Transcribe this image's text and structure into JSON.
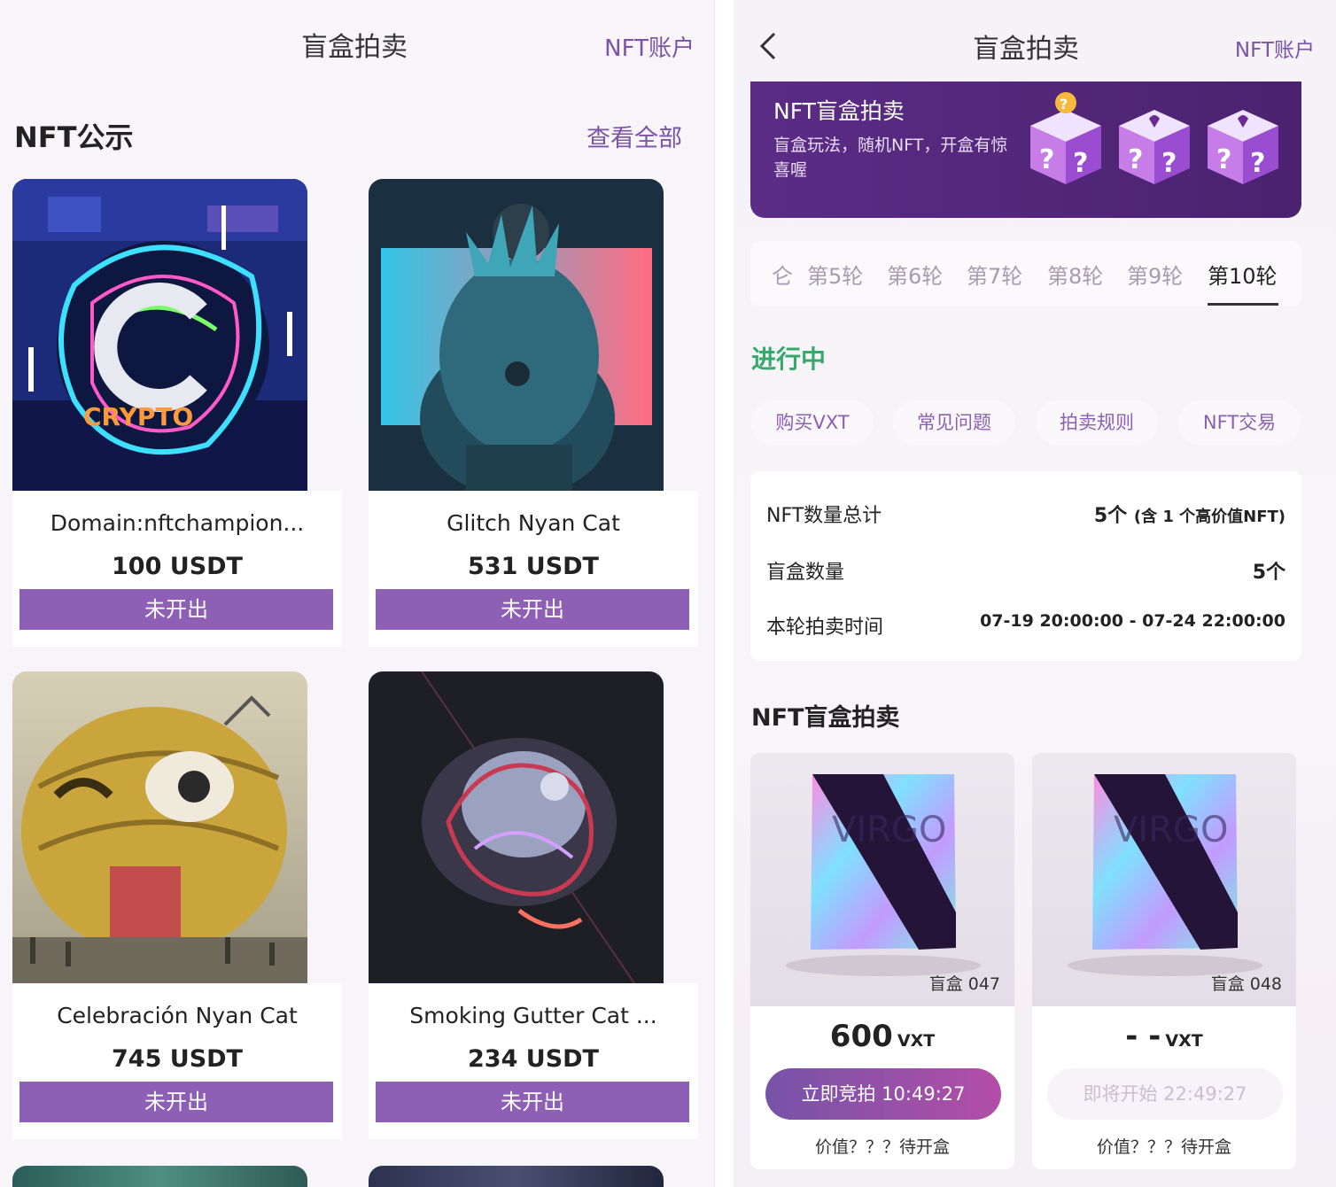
{
  "left": {
    "header": {
      "title": "盲盒拍卖",
      "account_label": "NFT账户"
    },
    "section": {
      "title": "NFT公示",
      "view_all": "查看全部"
    },
    "cards": [
      {
        "name": "Domain:nftchampion...",
        "price": "100 USDT",
        "status": "未开出"
      },
      {
        "name": "Glitch Nyan Cat",
        "price": "531 USDT",
        "status": "未开出"
      },
      {
        "name": "Celebración Nyan Cat",
        "price": "745 USDT",
        "status": "未开出"
      },
      {
        "name": "Smoking Gutter Cat ...",
        "price": "234 USDT",
        "status": "未开出"
      }
    ]
  },
  "right": {
    "header": {
      "title": "盲盒拍卖",
      "account_label": "NFT账户"
    },
    "banner": {
      "title": "NFT盲盒拍卖",
      "desc": "盲盒玩法，随机NFT，开盒有惊喜喔"
    },
    "rounds": {
      "items": [
        "仑",
        "第5轮",
        "第6轮",
        "第7轮",
        "第8轮",
        "第9轮",
        "第10轮"
      ],
      "active_index": 6
    },
    "status_title": "进行中",
    "quick_links": [
      "购买VXT",
      "常见问题",
      "拍卖规则",
      "NFT交易"
    ],
    "stats": [
      {
        "label": "NFT数量总计",
        "value": "5个",
        "note": "(含 1 个高价值NFT)"
      },
      {
        "label": "盲盒数量",
        "value": "5个",
        "note": ""
      },
      {
        "label": "本轮拍卖时间",
        "value": "07-19 20:00:00 - 07-24 22:00:00",
        "note": ""
      }
    ],
    "boxes_title": "NFT盲盒拍卖",
    "boxes": [
      {
        "id_label": "盲盒 047",
        "price": "600",
        "unit": "VXT",
        "button": "立即竞拍 10:49:27",
        "button_state": "live",
        "value_text": "价值？？？待开盒"
      },
      {
        "id_label": "盲盒 048",
        "price": "- -",
        "unit": "VXT",
        "button": "即将开始 22:49:27",
        "button_state": "soon",
        "value_text": "价值？？？待开盒"
      }
    ]
  },
  "colors": {
    "accent": "#8d5fb5",
    "link": "#7a53a6",
    "in_progress": "#36a86a",
    "banner": "#4f2575"
  },
  "icons": {
    "back": "chevron-left-icon"
  }
}
